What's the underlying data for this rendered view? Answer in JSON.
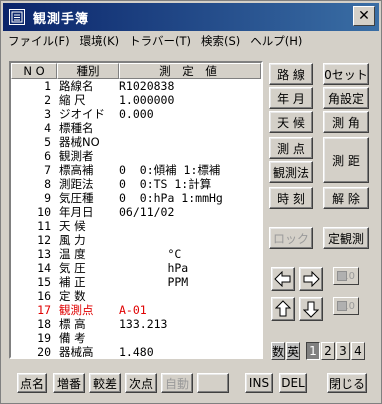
{
  "window": {
    "title": "観測手簿",
    "close_label": "✕"
  },
  "menu": [
    "ファイル(F)",
    "環境(K)",
    "トラバー(T)",
    "検索(S)",
    "ヘルプ(H)"
  ],
  "table": {
    "headers": {
      "no": "N O",
      "kind": "種別",
      "value": "測 定 値"
    },
    "rows": [
      {
        "no": "1",
        "kind": "路線名",
        "value": "R1020838",
        "red": false
      },
      {
        "no": "2",
        "kind": "縮 尺",
        "value": "1.000000",
        "red": false
      },
      {
        "no": "3",
        "kind": "ジオイド",
        "value": "0.000",
        "red": false
      },
      {
        "no": "4",
        "kind": "標種名",
        "value": "",
        "red": false
      },
      {
        "no": "5",
        "kind": "器械NO",
        "value": "",
        "red": false
      },
      {
        "no": "6",
        "kind": "観測者",
        "value": "",
        "red": false
      },
      {
        "no": "7",
        "kind": "標高補",
        "value": "0  0:傾補 1:標補",
        "red": false
      },
      {
        "no": "8",
        "kind": "測距法",
        "value": "0  0:TS 1:計算",
        "red": false
      },
      {
        "no": "9",
        "kind": "気圧種",
        "value": "0  0:hPa 1:mmHg",
        "red": false
      },
      {
        "no": "10",
        "kind": "年月日",
        "value": "06/11/02",
        "red": false
      },
      {
        "no": "11",
        "kind": "天 候",
        "value": "",
        "red": false
      },
      {
        "no": "12",
        "kind": "風 力",
        "value": "",
        "red": false
      },
      {
        "no": "13",
        "kind": "温 度",
        "value": "       °C",
        "red": false
      },
      {
        "no": "14",
        "kind": "気 圧",
        "value": "       hPa",
        "red": false
      },
      {
        "no": "15",
        "kind": "補 正",
        "value": "       PPM",
        "red": false
      },
      {
        "no": "16",
        "kind": "定 数",
        "value": "",
        "red": false
      },
      {
        "no": "17",
        "kind": "観測点",
        "value": "A-01",
        "red": true
      },
      {
        "no": "18",
        "kind": "標 高",
        "value": "133.213",
        "red": false
      },
      {
        "no": "19",
        "kind": "備 考",
        "value": "",
        "red": false
      },
      {
        "no": "20",
        "kind": "器械高",
        "value": "1.480",
        "red": false
      }
    ]
  },
  "buttons": {
    "route": "路 線",
    "zero_set": "0セット",
    "year_month": "年 月",
    "angle_set": "角設定",
    "weather": "天 候",
    "measure_angle": "測 角",
    "point": "測 点",
    "measure_distance": "測 距",
    "observation_method": "観測法",
    "time": "時 刻",
    "release": "解 除",
    "lock": "ロック",
    "fixed_observation": "定観測",
    "counter_top": "10",
    "counter_bottom": "10"
  },
  "mode_keys": [
    "数",
    "英",
    "1",
    "2",
    "3",
    "4"
  ],
  "bottom_buttons": {
    "point_name": "点名",
    "increment": "増番",
    "height_diff": "較差",
    "next_point": "次点",
    "auto": "自動",
    "blank": "",
    "ins": "INS",
    "del": "DEL",
    "close": "閉じる"
  }
}
